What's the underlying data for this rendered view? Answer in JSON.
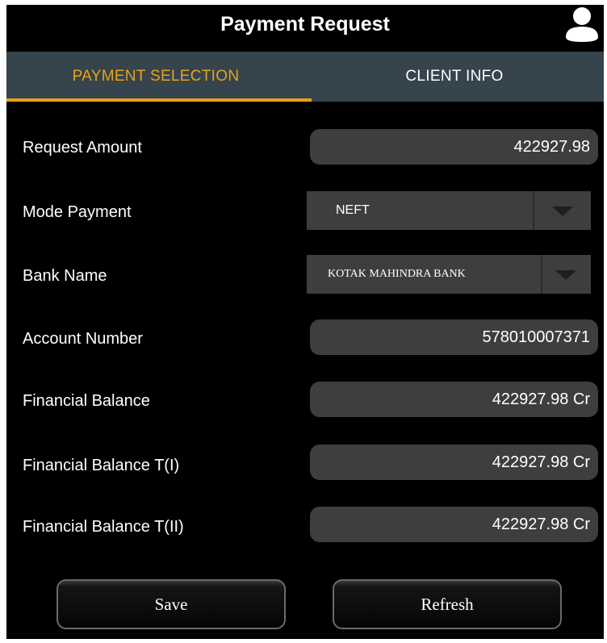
{
  "header": {
    "title": "Payment Request"
  },
  "tabs": [
    {
      "label": "PAYMENT SELECTION",
      "active": true
    },
    {
      "label": "CLIENT INFO",
      "active": false
    }
  ],
  "form": {
    "request_amount": {
      "label": "Request Amount",
      "value": "422927.98"
    },
    "mode_payment": {
      "label": "Mode Payment",
      "value": "NEFT"
    },
    "bank_name": {
      "label": "Bank Name",
      "value": "KOTAK MAHINDRA BANK"
    },
    "account_number": {
      "label": "Account Number",
      "value": "578010007371"
    },
    "financial_balance": {
      "label": "Financial Balance",
      "value": "422927.98 Cr"
    },
    "financial_balance_t1": {
      "label": "Financial Balance T(I)",
      "value": "422927.98 Cr"
    },
    "financial_balance_t2": {
      "label": "Financial Balance T(II)",
      "value": "422927.98 Cr"
    }
  },
  "buttons": {
    "save": "Save",
    "refresh": "Refresh"
  },
  "colors": {
    "accent": "#e8a316",
    "tab_bar": "#35444d",
    "field_bg": "#3e3e3e"
  },
  "icons": {
    "user": "user-icon",
    "dropdown": "chevron-down-icon"
  }
}
